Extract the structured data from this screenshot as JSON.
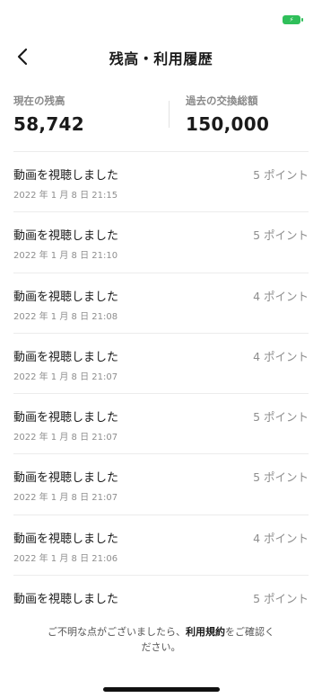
{
  "header": {
    "title": "残高・利用履歴",
    "back_icon": "chevron-left-icon"
  },
  "summary": {
    "current_label": "現在の残高",
    "current_value": "58,742",
    "total_label": "過去の交換総額",
    "total_value": "150,000"
  },
  "history": [
    {
      "title": "動画を視聴しました",
      "date": "2022 年 1 月 8 日 21:15",
      "points": "5 ポイント"
    },
    {
      "title": "動画を視聴しました",
      "date": "2022 年 1 月 8 日 21:10",
      "points": "5 ポイント"
    },
    {
      "title": "動画を視聴しました",
      "date": "2022 年 1 月 8 日 21:08",
      "points": "4 ポイント"
    },
    {
      "title": "動画を視聴しました",
      "date": "2022 年 1 月 8 日 21:07",
      "points": "4 ポイント"
    },
    {
      "title": "動画を視聴しました",
      "date": "2022 年 1 月 8 日 21:07",
      "points": "5 ポイント"
    },
    {
      "title": "動画を視聴しました",
      "date": "2022 年 1 月 8 日 21:07",
      "points": "5 ポイント"
    },
    {
      "title": "動画を視聴しました",
      "date": "2022 年 1 月 8 日 21:06",
      "points": "4 ポイント"
    },
    {
      "title": "動画を視聴しました",
      "date": "",
      "points": "5 ポイント"
    }
  ],
  "footer": {
    "note_before": "ご不明な点がございましたら、",
    "terms_link": "利用規約",
    "note_after": "をご確認ください。"
  },
  "colors": {
    "battery": "#2fbf5a",
    "muted_text": "#8e8e8e"
  }
}
